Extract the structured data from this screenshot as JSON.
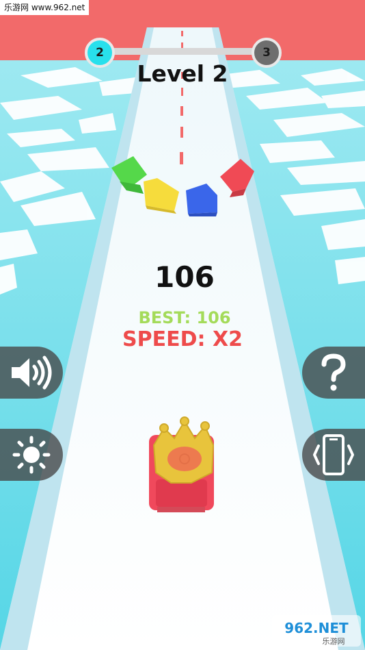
{
  "watermark": {
    "top_text": "乐游网 www.962.net",
    "bottom_logo_text": "962.NET",
    "bottom_logo_sub": "乐游网"
  },
  "progress": {
    "current_level": "2",
    "next_level": "3",
    "fraction": 0.0
  },
  "level_title": "Level 2",
  "score": "106",
  "best": "BEST: 106",
  "speed": "SPEED: X2",
  "buttons": {
    "sound": "speaker-icon",
    "help": "question-icon",
    "brightness": "sun-icon",
    "vibration": "phone-vibrate-icon"
  },
  "colors": {
    "sky": "#f26a6a",
    "water": "#7fe3ec",
    "road": "#e9f7fb",
    "accent": "#28e0ec",
    "best": "#a4db5a",
    "speed": "#ee4b4b",
    "blocks": [
      "#55d84a",
      "#f6dc3c",
      "#3a66ea",
      "#f04a55"
    ],
    "car": "#f0495c",
    "crown": "#e8c43c"
  }
}
